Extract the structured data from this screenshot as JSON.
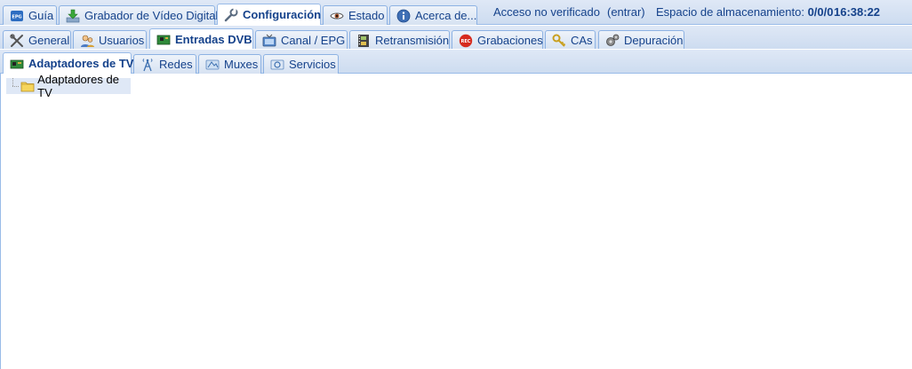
{
  "main_tabs": [
    {
      "label": "Guía",
      "icon": "epg-icon",
      "active": false
    },
    {
      "label": "Grabador de Vídeo Digital",
      "icon": "download-icon",
      "active": false
    },
    {
      "label": "Configuración",
      "icon": "wrench-icon",
      "active": true
    },
    {
      "label": "Estado",
      "icon": "eye-icon",
      "active": false
    },
    {
      "label": "Acerca de...",
      "icon": "info-icon",
      "active": false
    }
  ],
  "status": {
    "access": "Acceso no verificado",
    "login": "(entrar)",
    "storage_label": "Espacio de almacenamiento:",
    "storage_value": "0/0/0",
    "time": "16:38:22"
  },
  "config_tabs": [
    {
      "label": "General",
      "icon": "tools-icon",
      "active": false
    },
    {
      "label": "Usuarios",
      "icon": "users-icon",
      "active": false
    },
    {
      "label": "Entradas DVB",
      "icon": "dvb-card-icon",
      "active": true
    },
    {
      "label": "Canal / EPG",
      "icon": "tv-icon",
      "active": false
    },
    {
      "label": "Retransmisión",
      "icon": "film-icon",
      "active": false
    },
    {
      "label": "Grabaciones",
      "icon": "rec-icon",
      "active": false
    },
    {
      "label": "CAs",
      "icon": "key-icon",
      "active": false
    },
    {
      "label": "Depuración",
      "icon": "bug-icon",
      "active": false
    }
  ],
  "dvb_tabs": [
    {
      "label": "Adaptadores de TV",
      "icon": "adapter-card-icon",
      "active": true
    },
    {
      "label": "Redes",
      "icon": "antenna-icon",
      "active": false
    },
    {
      "label": "Muxes",
      "icon": "satellite-icon",
      "active": false
    },
    {
      "label": "Servicios",
      "icon": "service-icon",
      "active": false
    }
  ],
  "tree": {
    "root_label": "Adaptadores de TV"
  },
  "colors": {
    "accent": "#15428b",
    "tab_border": "#99bbe8",
    "bar_bg": "#dfe8f6",
    "rec_red": "#d62b1e"
  }
}
